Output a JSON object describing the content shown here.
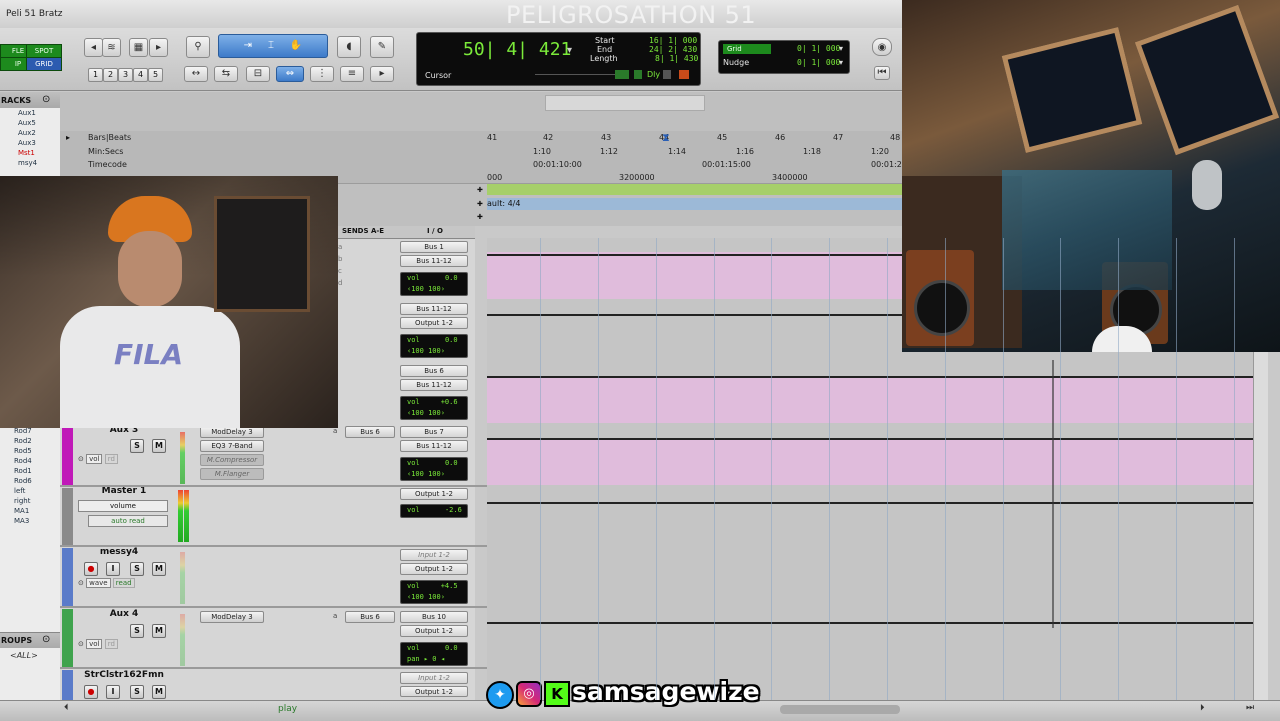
{
  "window": {
    "title": "Peli 51 Bratz"
  },
  "stream_title": "PELIGROSATHON 51",
  "toolbar": {
    "modes": [
      "FLE",
      "SPOT",
      "IP",
      "GRID"
    ],
    "zoom_presets": [
      "1",
      "2",
      "3",
      "4",
      "5"
    ],
    "counter": {
      "main": "50| 4| 421",
      "label": "Cursor"
    },
    "selection": {
      "start_label": "Start",
      "end_label": "End",
      "length_label": "Length",
      "start": "16| 1| 000",
      "end": "24| 2| 430",
      "length": "8| 1| 430"
    },
    "dly_label": "Dly",
    "grid": {
      "label": "Grid",
      "value": "0| 1| 000"
    },
    "nudge": {
      "label": "Nudge",
      "value": "0| 1| 000"
    }
  },
  "tracks_panel": {
    "header": "RACKS",
    "items_top": [
      "Aux1",
      "Aux5",
      "Aux2",
      "Aux3",
      "Mst1",
      "msy4"
    ],
    "items_bottom": [
      "Rod7",
      "Rod2",
      "Rod5",
      "Rod4",
      "Rod1",
      "Rod6",
      "left",
      "right",
      "MA1",
      "MA3"
    ],
    "groups_header": "ROUPS",
    "groups_all": "<ALL>"
  },
  "rulers": {
    "bars_label": "Bars|Beats",
    "minsecs_label": "Min:Secs",
    "timecode_label": "Timecode",
    "bars": [
      "41",
      "42",
      "43",
      "44",
      "45",
      "46",
      "47",
      "48"
    ],
    "minsecs": [
      "1:10",
      "1:12",
      "1:14",
      "1:16",
      "1:18",
      "1:20"
    ],
    "timecode": [
      "00:01:10:00",
      "00:01:15:00",
      "00:01:2"
    ],
    "samples": [
      "000",
      "3200000",
      "3400000"
    ],
    "meter": "ault: 4/4"
  },
  "mix_header": {
    "sends": "SENDS A-E",
    "io": "I / O"
  },
  "io_rows": [
    {
      "in": "Bus 1",
      "out": "Bus 11-12",
      "vol": "0.0",
      "pan": "‹100  100›"
    },
    {
      "in": "Bus 11-12",
      "out": "Output 1-2",
      "vol": "0.0",
      "pan": "‹100  100›"
    },
    {
      "in": "Bus 6",
      "out": "Bus 11-12",
      "vol": "+0.6",
      "pan": "‹100  100›"
    },
    {
      "in": "Bus 7",
      "out": "Bus 11-12",
      "vol": "0.0",
      "pan": "‹100  100›"
    },
    {
      "in": "",
      "out": "Output 1-2",
      "vol": "-2.6",
      "pan": ""
    },
    {
      "in": "Input 1-2",
      "out": "Output 1-2",
      "vol": "+4.5",
      "pan": "‹100  100›"
    },
    {
      "in": "Bus 10",
      "out": "Output 1-2",
      "vol": "0.0",
      "pan": "pan  ▸ 0 ◂"
    },
    {
      "in": "Input 1-2",
      "out": "Output 1-2",
      "vol": "",
      "pan": ""
    }
  ],
  "tracks": {
    "aux3": {
      "name": "Aux 3",
      "inserts": [
        "ModDelay 3",
        "EQ3 7-Band",
        "M.Compressor",
        "M.Flanger"
      ],
      "send": "Bus 6",
      "vol_label": "vol",
      "mode": "rd"
    },
    "master": {
      "name": "Master 1",
      "auto_param": "volume",
      "auto_mode": "auto read"
    },
    "messy": {
      "name": "messy4",
      "view": "wave",
      "mode": "read"
    },
    "aux4": {
      "name": "Aux 4",
      "insert": "ModDelay 3",
      "send": "Bus 6",
      "vol_label": "vol",
      "mode": "rd"
    },
    "str": {
      "name": "StrClstr162Fmn"
    }
  },
  "sends_letters": [
    "a",
    "b",
    "c",
    "d"
  ],
  "transport_label": "play",
  "social": {
    "handle": "samsagewize",
    "icons": [
      "twitter-icon",
      "instagram-icon",
      "kick-icon"
    ]
  },
  "colors": {
    "clip": "#e0bcdc",
    "counter_green": "#7bea3a",
    "aux_color": "#c019b8",
    "master_green": "#1d8a1d"
  }
}
